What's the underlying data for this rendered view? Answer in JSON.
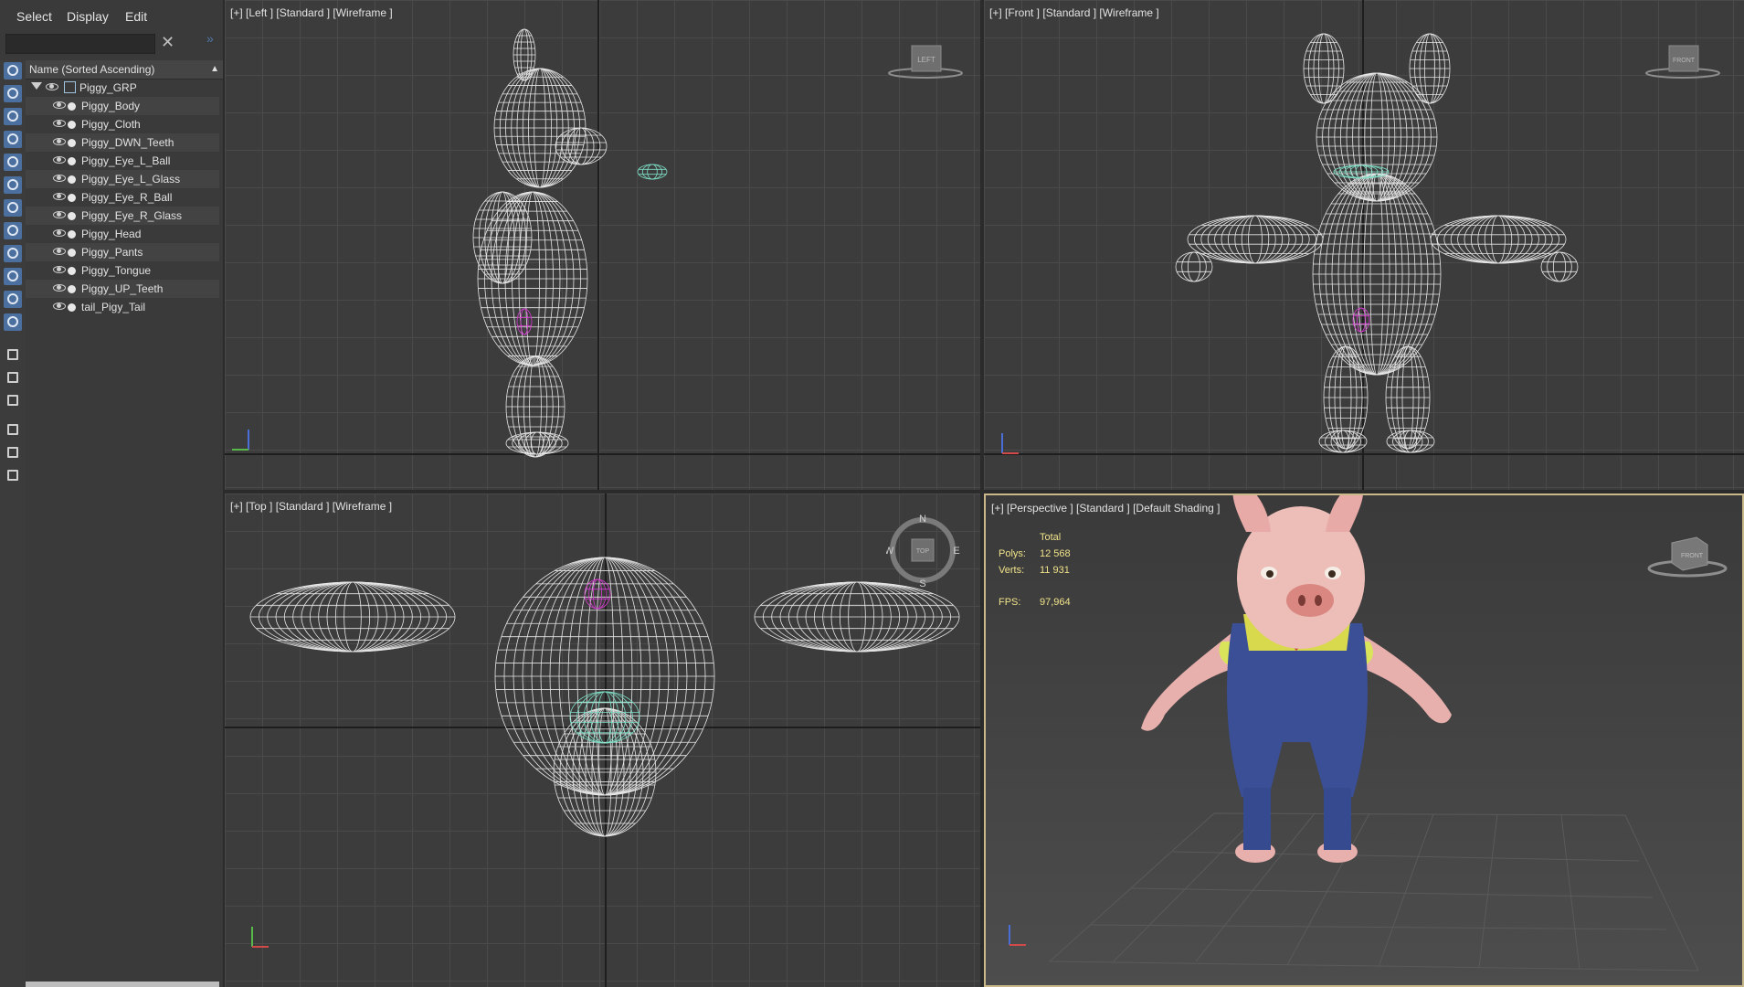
{
  "menu": {
    "select": "Select",
    "display": "Display",
    "edit": "Edit"
  },
  "filter": {
    "value": "",
    "clear_icon": "close-icon"
  },
  "explorer": {
    "column_header": "Name (Sorted Ascending)",
    "group": "Piggy_GRP",
    "items": [
      "Piggy_Body",
      "Piggy_Cloth",
      "Piggy_DWN_Teeth",
      "Piggy_Eye_L_Ball",
      "Piggy_Eye_L_Glass",
      "Piggy_Eye_R_Ball",
      "Piggy_Eye_R_Glass",
      "Piggy_Head",
      "Piggy_Pants",
      "Piggy_Tongue",
      "Piggy_UP_Teeth",
      "tail_Pigy_Tail"
    ]
  },
  "viewports": {
    "left": {
      "label": "[+] [Left ] [Standard ] [Wireframe ]",
      "cube": "LEFT"
    },
    "front": {
      "label": "[+] [Front ] [Standard ] [Wireframe ]",
      "cube": "FRONT"
    },
    "top": {
      "label": "[+] [Top ] [Standard ] [Wireframe ]",
      "cube": "TOP",
      "compass": {
        "n": "N",
        "s": "S",
        "e": "E",
        "w": "W"
      }
    },
    "persp": {
      "label": "[+] [Perspective ] [Standard ] [Default Shading ]",
      "cube": "FRONT"
    }
  },
  "stats": {
    "total_label": "Total",
    "polys_label": "Polys:",
    "polys_value": "12 568",
    "verts_label": "Verts:",
    "verts_value": "11 931",
    "fps_label": "FPS:",
    "fps_value": "97,964"
  },
  "colors": {
    "wire": "#e6e6e6",
    "tail": "#d63bd1",
    "teeth": "#7ee0c7",
    "accent": "#4b6f9e",
    "active_border": "#c9b98a",
    "stats_text": "#f1e38a"
  }
}
